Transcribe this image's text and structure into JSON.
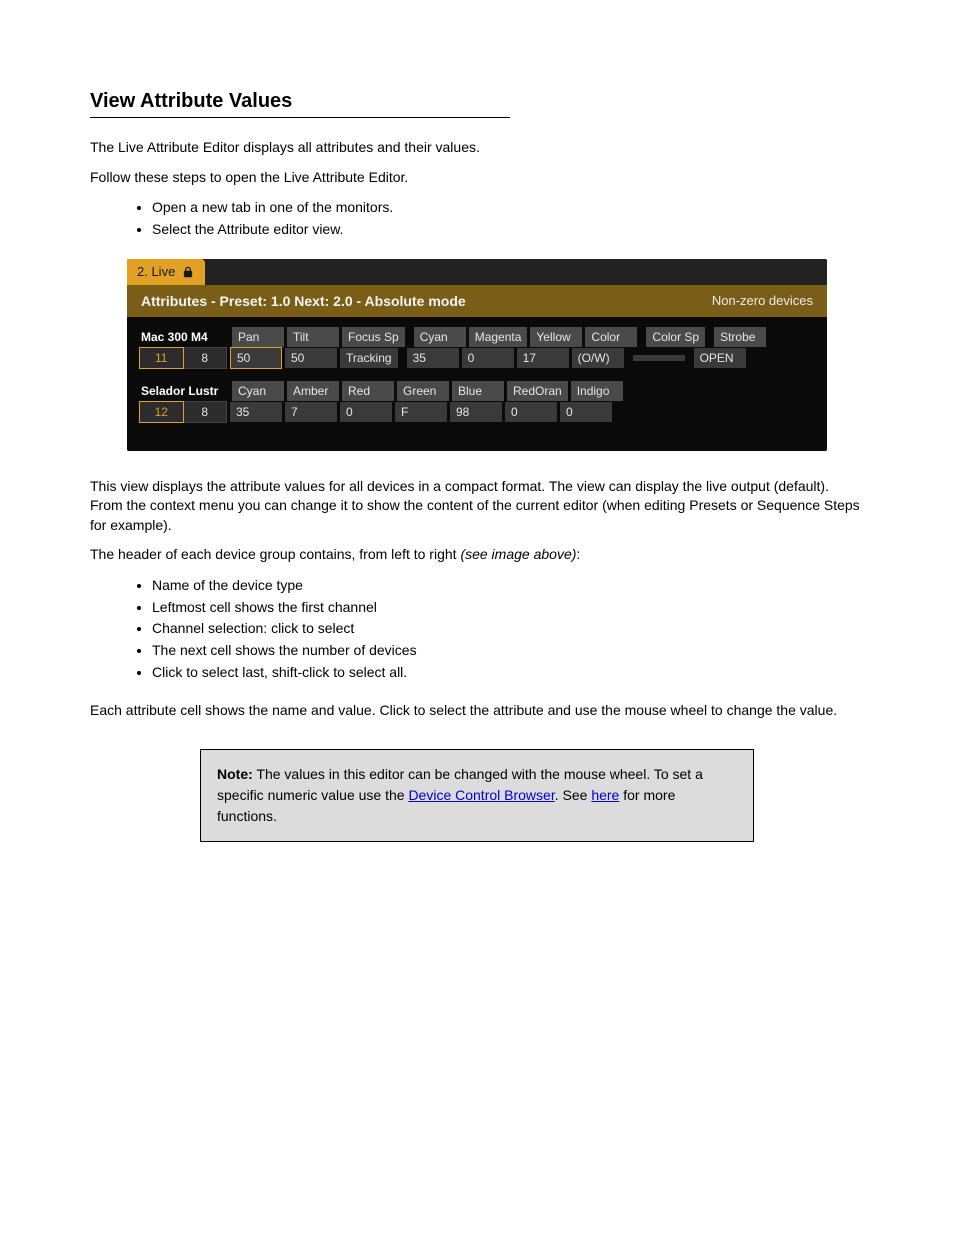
{
  "section": {
    "title": "View Attribute Values",
    "intro": "The Live Attribute Editor displays all attributes and their values.",
    "steps_intro": "Follow these steps to open the Live Attribute Editor.",
    "bullets_top": [
      "Open a new tab in one of the monitors.",
      "Select the Attribute editor view."
    ]
  },
  "screenshot": {
    "tab_label": "2. Live",
    "header_left": "Attributes - Preset: 1.0 Next: 2.0 - Absolute mode",
    "header_right": "Non-zero devices",
    "devices": [
      {
        "name": "Mac 300 M4",
        "ids": [
          "11",
          "8"
        ],
        "headers": [
          "Pan",
          "Tilt",
          "Focus Sp",
          "Cyan",
          "Magenta",
          "Yellow",
          "Color",
          "Color Sp",
          "Strobe"
        ],
        "values": [
          "50",
          "50",
          "Tracking",
          "35",
          "0",
          "17",
          "(O/W)",
          "",
          "OPEN"
        ],
        "group_breaks_after": [
          2,
          6,
          7
        ],
        "selected_value_index": 0
      },
      {
        "name": "Selador Lustr",
        "ids": [
          "12",
          "8"
        ],
        "headers": [
          "Cyan",
          "Amber",
          "Red",
          "Green",
          "Blue",
          "RedOran",
          "Indigo"
        ],
        "values": [
          "35",
          "7",
          "0",
          "F",
          "98",
          "0",
          "0"
        ],
        "group_breaks_after": [],
        "selected_value_index": null
      }
    ]
  },
  "after_shot": {
    "p1": "This view displays the attribute values for all devices in a compact format. The view can display the live output (default). From the context menu you can change it to show the content of the current editor (when editing Presets or Sequence Steps for example).",
    "p2_before": "The header of each device group contains, from left to right ",
    "p2_italic": "(see image above)",
    "p2_after": ":",
    "bullets": [
      "Name of the device type",
      "Leftmost cell shows the first channel",
      "Channel selection: click to select",
      "The next cell shows the number of devices",
      "Click to select last, shift-click to select all."
    ],
    "p3": "Each attribute cell shows the name and value. Click to select the attribute and use the mouse wheel to change the value."
  },
  "note": {
    "label": "Note:",
    "text_before": " The values in this editor can be changed with the mouse wheel. To set a specific numeric value use the ",
    "link_text": "Device Control Browser",
    "text_after": ".",
    "link2_text": "here",
    "sentence2_before": " See ",
    "sentence2_after": " for more functions."
  }
}
